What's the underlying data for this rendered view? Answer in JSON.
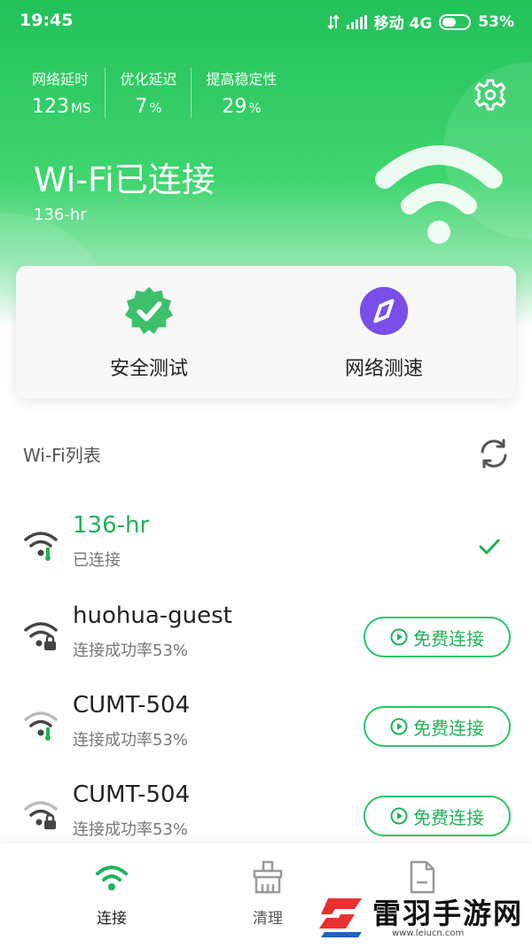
{
  "status_bar": {
    "time": "19:45",
    "carrier": "移动 4G",
    "battery": "53%",
    "battery_level": 0.53
  },
  "stats": [
    {
      "label": "网络延时",
      "value": "123",
      "unit": "MS"
    },
    {
      "label": "优化延迟",
      "value": "7",
      "unit": "%"
    },
    {
      "label": "提高稳定性",
      "value": "29",
      "unit": "%"
    }
  ],
  "connection": {
    "title": "Wi-Fi已连接",
    "ssid": "136-hr"
  },
  "actions": {
    "security_test": "安全测试",
    "speed_test": "网络测速"
  },
  "wifi_list": {
    "title": "Wi-Fi列表",
    "items": [
      {
        "name": "136-hr",
        "status": "已连接",
        "connected": true
      },
      {
        "name": "huohua-guest",
        "status": "连接成功率53%",
        "button": "免费连接"
      },
      {
        "name": "CUMT-504",
        "status": "连接成功率53%",
        "button": "免费连接"
      },
      {
        "name": "CUMT-504",
        "status": "连接成功率53%",
        "button": "免费连接"
      }
    ]
  },
  "tabs": [
    {
      "label": "连接",
      "active": true
    },
    {
      "label": "清理",
      "active": false
    },
    {
      "label": "",
      "active": false
    }
  ],
  "watermark": {
    "text": "雷羽手游网",
    "url": "www.leiucn.com"
  },
  "colors": {
    "brand_green": "#22c15a",
    "accent_text_green": "#20b25a",
    "purple": "#7a4ee8"
  },
  "icons": {
    "settings": "gear-icon",
    "refresh": "refresh-icon",
    "connected": "check-icon"
  }
}
